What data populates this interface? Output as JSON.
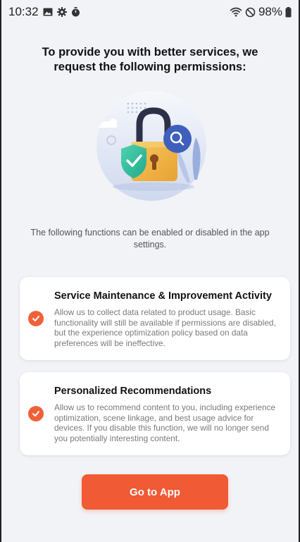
{
  "status_bar": {
    "time": "10:32",
    "battery": "98%",
    "icons": [
      "gallery-icon",
      "gear-icon",
      "timer-icon",
      "wifi-icon",
      "do-not-disturb-icon",
      "battery-icon"
    ]
  },
  "title": "To provide you with better services, we request the following permissions:",
  "subtitle": "The following functions can be enabled or disabled in the app settings.",
  "permissions": [
    {
      "title": "Service Maintenance & Improvement Activity",
      "description": "Allow us to collect data related to product usage. Basic functionality will still be available if permissions are disabled, but the experience optimization policy based on data preferences will be ineffective.",
      "checked": true
    },
    {
      "title": "Personalized Recommendations",
      "description": "Allow us to recommend content to you, including experience optimization, scene linkage, and best usage advice for devices. If you disable this function, we will no longer send you potentially interesting content.",
      "checked": true
    }
  ],
  "primary_button": {
    "label": "Go to App"
  },
  "colors": {
    "accent": "#f05a34",
    "background": "#f2f3f7",
    "card": "#ffffff",
    "text_primary": "#111111",
    "text_secondary": "#7a7a7a"
  }
}
